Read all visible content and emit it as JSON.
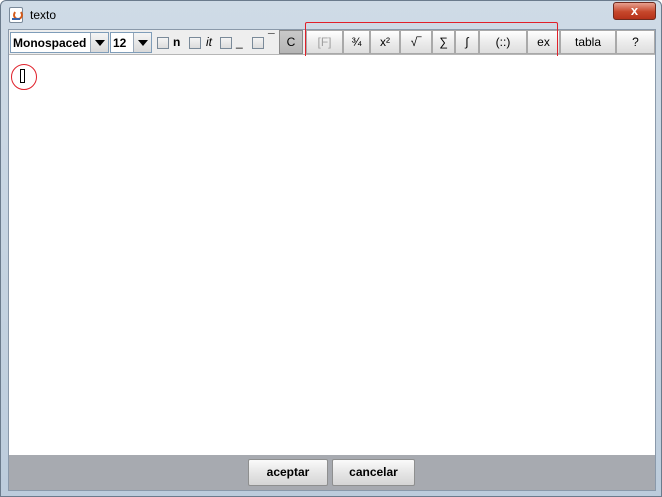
{
  "window": {
    "title": "texto",
    "close_label": "x"
  },
  "toolbar": {
    "font_combo": {
      "value": "Monospaced"
    },
    "size_combo": {
      "value": "12"
    },
    "style_checks": [
      {
        "label": "n"
      },
      {
        "label": "it"
      },
      {
        "label": "_"
      },
      {
        "label": "¯"
      }
    ],
    "c_label": "C",
    "buttons": [
      {
        "label": "[F]",
        "enabled": false
      },
      {
        "label": "¾",
        "enabled": true
      },
      {
        "label": "x²",
        "enabled": true
      },
      {
        "label": "√‾",
        "enabled": true
      },
      {
        "label": "∑",
        "enabled": true
      },
      {
        "label": "∫",
        "enabled": true
      },
      {
        "label": "(::)",
        "enabled": true
      },
      {
        "label": "ex",
        "enabled": true
      },
      {
        "label": "tabla",
        "enabled": true
      },
      {
        "label": "?",
        "enabled": true
      }
    ],
    "highlight_color": "#e0202a"
  },
  "editor": {
    "text": ""
  },
  "footer": {
    "accept_label": "aceptar",
    "cancel_label": "cancelar"
  }
}
